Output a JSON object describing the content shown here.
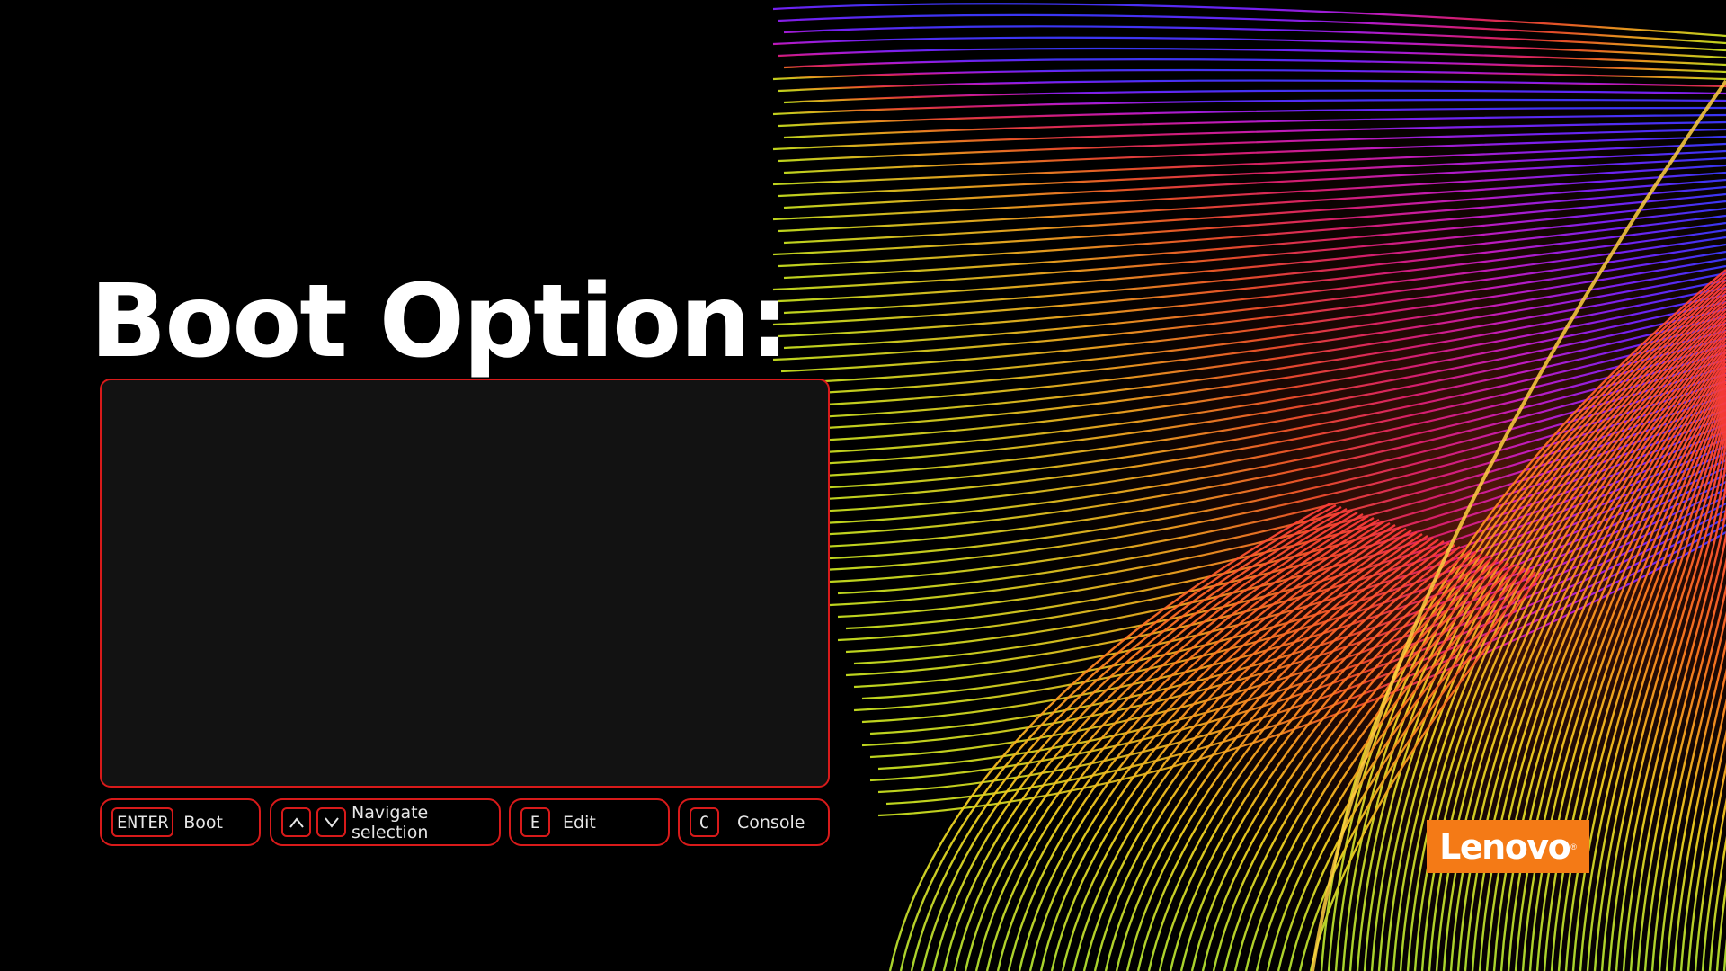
{
  "page": {
    "title": "Boot Option:",
    "accent_color": "#d81a1a",
    "panel_color": "#121212"
  },
  "boot_menu": {
    "entries": []
  },
  "hints": [
    {
      "keys": [
        "ENTER"
      ],
      "label": "Boot"
    },
    {
      "keys": [
        "up-arrow-icon",
        "down-arrow-icon"
      ],
      "label": "Navigate selection"
    },
    {
      "keys": [
        "E"
      ],
      "label": "Edit"
    },
    {
      "keys": [
        "C"
      ],
      "label": "Console"
    }
  ],
  "brand": {
    "name": "Lenovo",
    "color": "#f47a16"
  }
}
